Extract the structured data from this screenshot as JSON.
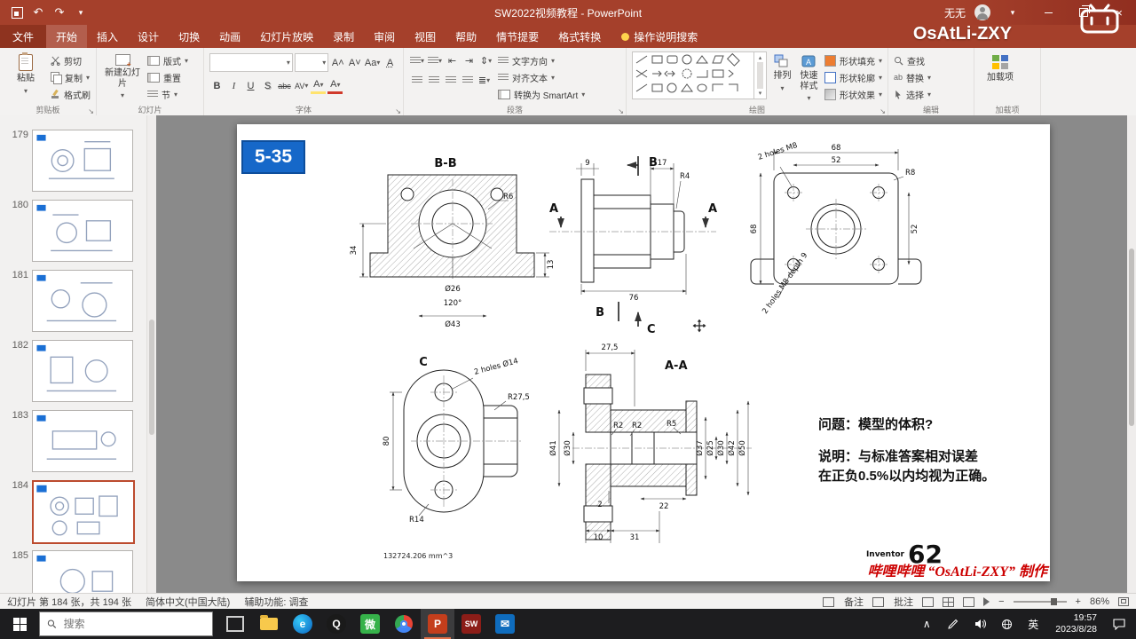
{
  "titlebar": {
    "title": "SW2022视频教程  -  PowerPoint",
    "user": "无无"
  },
  "watermark": {
    "name": "OsAtLi-ZXY",
    "logo": "bilibili"
  },
  "ribbon": {
    "file_tab": "文件",
    "tabs": [
      "开始",
      "插入",
      "设计",
      "切换",
      "动画",
      "幻灯片放映",
      "录制",
      "审阅",
      "视图",
      "帮助",
      "情节提要",
      "格式转换"
    ],
    "tell_me": "操作说明搜索",
    "clipboard": {
      "group": "剪贴板",
      "paste": "粘贴",
      "cut": "剪切",
      "copy": "复制",
      "painter": "格式刷"
    },
    "slides": {
      "group": "幻灯片",
      "new_slide": "新建幻灯片",
      "layout": "版式",
      "reset": "重置",
      "section": "节"
    },
    "font": {
      "group": "字体"
    },
    "paragraph": {
      "group": "段落",
      "text_dir": "文字方向",
      "align_text": "对齐文本",
      "smartart": "转换为 SmartArt"
    },
    "drawing": {
      "group": "绘图",
      "arrange": "排列",
      "quick_styles": "快速样式",
      "shape_fill": "形状填充",
      "shape_outline": "形状轮廓",
      "shape_effects": "形状效果"
    },
    "editing": {
      "group": "编辑",
      "find": "查找",
      "replace": "替换",
      "select": "选择"
    },
    "addins": {
      "group": "加载项",
      "button": "加载项"
    }
  },
  "sidebar": {
    "slides": [
      "179",
      "180",
      "181",
      "182",
      "183",
      "184",
      "185"
    ],
    "selected": "184"
  },
  "slide": {
    "tag": "5-35",
    "question": "问题：模型的体积?",
    "note_line1": "说明：与标准答案相对误差",
    "note_line2": "在正负0.5%以内均视为正确。",
    "volume": "132724.206 mm^3",
    "inventor": "Inventor",
    "answer": "62",
    "credit": "哔哩哔哩 “OsAtLi-ZXY” 制作",
    "views": {
      "bb": {
        "label": "B-B",
        "d34": "34",
        "d26": "Ø26",
        "d120": "120°",
        "d43": "Ø43",
        "r6": "R6",
        "d13": "13"
      },
      "side": {
        "a": "A",
        "b": "B",
        "c": "C",
        "d9": "9",
        "d17": "17",
        "r4": "R4",
        "d76": "76"
      },
      "front": {
        "d68_top": "68",
        "d52_top": "52",
        "r8": "R8",
        "d68_left": "68",
        "d52_right": "52",
        "note_top": "2 holes M8",
        "note_bottom": "2 holes M8 depth 9"
      },
      "c": {
        "label": "C",
        "note": "2 holes Ø14",
        "d80": "80",
        "r27": "R27,5",
        "r14": "R14"
      },
      "aa": {
        "label": "A-A",
        "d27": "27,5",
        "d41": "Ø41",
        "d30_left": "Ø30",
        "r2a": "R2",
        "r2b": "R2",
        "r5": "R5",
        "d37": "Ø37",
        "d25": "Ø25",
        "d30_right": "Ø30",
        "d42": "Ø42",
        "d50": "Ø50",
        "d2": "2",
        "d22": "22",
        "d10": "10",
        "d31": "31"
      }
    }
  },
  "statusbar": {
    "slide_info": "幻灯片 第 184 张，共 194 张",
    "language": "简体中文(中国大陆)",
    "accessibility": "辅助功能: 调查",
    "notes": "备注",
    "comments": "批注",
    "zoom": "86%"
  },
  "taskbar": {
    "search_placeholder": "搜索",
    "ime": "英",
    "time": "19:57",
    "date": "2023/8/28"
  }
}
